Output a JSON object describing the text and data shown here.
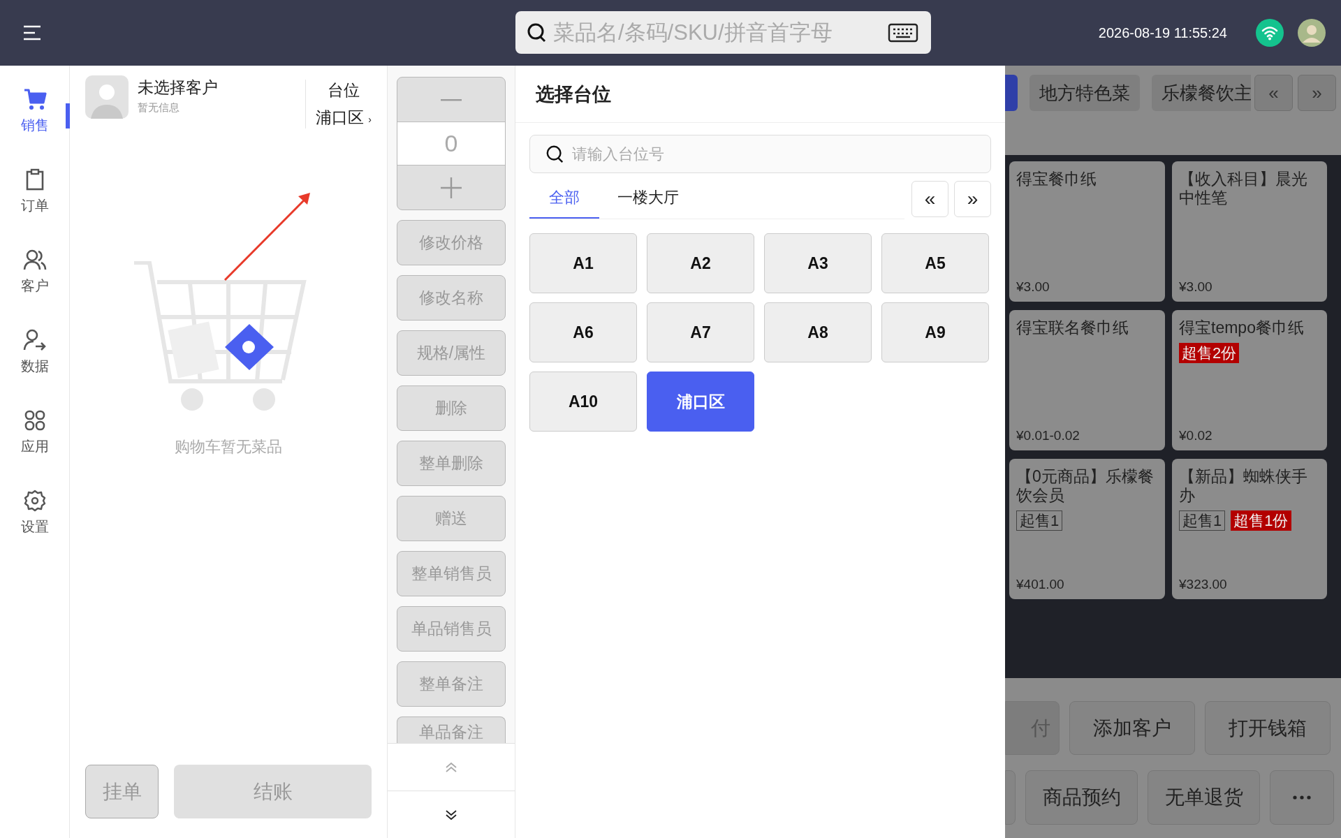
{
  "top_bar": {
    "search_placeholder": "菜品名/条码/SKU/拼音首字母",
    "datetime": "2026-08-19 11:55:24"
  },
  "nav": [
    {
      "label": "销售",
      "kind": "cart",
      "selected": true
    },
    {
      "label": "订单",
      "kind": "clipboard",
      "selected": false
    },
    {
      "label": "客户",
      "kind": "people",
      "selected": false
    },
    {
      "label": "数据",
      "kind": "person",
      "selected": false
    },
    {
      "label": "应用",
      "kind": "apps",
      "selected": false
    },
    {
      "label": "设置",
      "kind": "gear",
      "selected": false
    }
  ],
  "customer": {
    "name": "未选择客户",
    "info": "暂无信息"
  },
  "table_info": {
    "label": "台位",
    "value": "浦口区",
    "chevron": "›"
  },
  "cart": {
    "empty_text": "购物车暂无菜品"
  },
  "cart_buttons": [
    {
      "label": "挂单",
      "kind": "outline"
    },
    {
      "label": "结账",
      "kind": "wide"
    }
  ],
  "stepper": {
    "value": "0"
  },
  "actions": [
    "修改价格",
    "修改名称",
    "规格/属性",
    "删除",
    "整单删除",
    "赠送",
    "整单销售员",
    "单品销售员",
    "整单备注",
    "单品备注"
  ],
  "modal": {
    "title": "选择台位",
    "search_placeholder": "请输入台位号",
    "tabs": [
      {
        "label": "全部",
        "selected": true
      },
      {
        "label": "一楼大厅",
        "selected": false
      }
    ],
    "prev": "«",
    "next": "»",
    "tables": [
      {
        "label": "A1",
        "selected": false
      },
      {
        "label": "A2",
        "selected": false
      },
      {
        "label": "A3",
        "selected": false
      },
      {
        "label": "A5",
        "selected": false
      },
      {
        "label": "A6",
        "selected": false
      },
      {
        "label": "A7",
        "selected": false
      },
      {
        "label": "A8",
        "selected": false
      },
      {
        "label": "A9",
        "selected": false
      },
      {
        "label": "A10",
        "selected": false
      },
      {
        "label": "浦口区",
        "selected": true
      }
    ]
  },
  "category_partial": {
    "selected": true
  },
  "categories": [
    {
      "label": "地方特色菜",
      "selected": false
    },
    {
      "label": "乐檬餐饮主",
      "selected": false
    }
  ],
  "category_nav": {
    "prev": "«",
    "next": "»"
  },
  "products": [
    {
      "name": "得宝餐巾纸",
      "price": "¥3.00"
    },
    {
      "name": "【收入科目】晨光中性笔",
      "price": "¥3.00"
    },
    {
      "name": "得宝联名餐巾纸",
      "price": "¥0.01-0.02"
    },
    {
      "name": "得宝tempo餐巾纸",
      "price": "¥0.02",
      "tags": [
        {
          "text": "超售2份",
          "kind": "oversold"
        }
      ]
    },
    {
      "name": "【0元商品】乐檬餐饮会员",
      "price": "¥401.00",
      "tags": [
        {
          "text": "起售1",
          "kind": "minimum"
        }
      ]
    },
    {
      "name": "【新品】蜘蛛侠手办",
      "price": "¥323.00",
      "tags": [
        {
          "text": "起售1",
          "kind": "minimum"
        },
        {
          "text": "超售1份",
          "kind": "oversold"
        }
      ]
    }
  ],
  "bottom_actions": {
    "row1_partial": "付",
    "row1": [
      "添加客户",
      "打开钱箱"
    ],
    "row2": [
      "商品预约",
      "无单退货"
    ]
  }
}
